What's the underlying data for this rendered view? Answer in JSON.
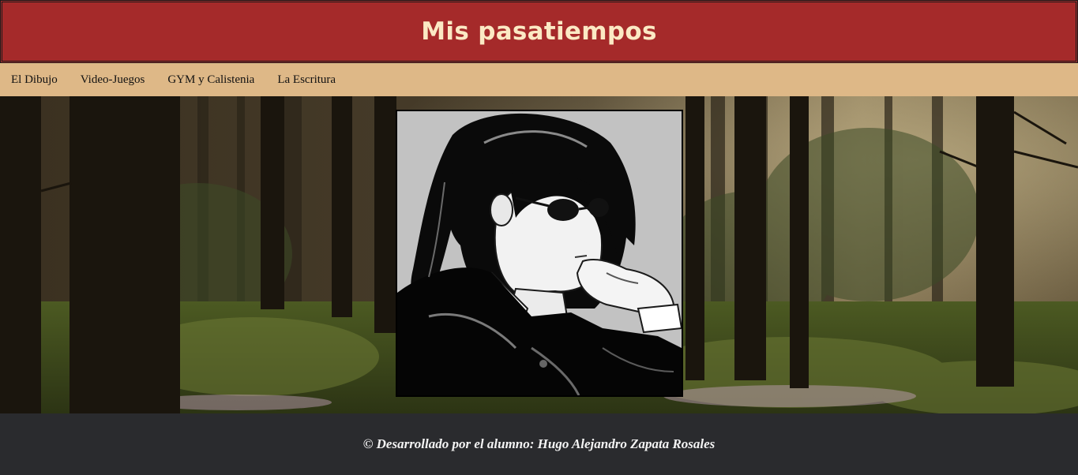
{
  "header": {
    "title": "Mis pasatiempos",
    "background_color": "#a52a2a",
    "title_color": "#fbe9c4"
  },
  "nav": {
    "background_color": "#deb887",
    "items": [
      {
        "label": "El Dibujo"
      },
      {
        "label": "Video-Juegos"
      },
      {
        "label": "GYM y Calistenia"
      },
      {
        "label": "La Escritura"
      }
    ]
  },
  "main": {
    "background_image": "forest",
    "featured_image": "anime-girl-glasses-drawing"
  },
  "footer": {
    "text": "© Desarrollado por el alumno: Hugo Alejandro Zapata Rosales",
    "background_color": "#2a2b2e"
  }
}
